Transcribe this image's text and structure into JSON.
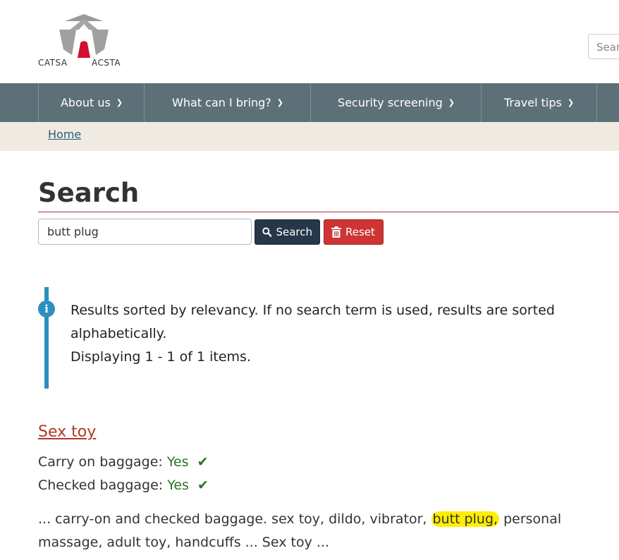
{
  "header": {
    "logo": {
      "left_text": "CATSA",
      "right_text": "ACSTA"
    },
    "search_placeholder": "Sear"
  },
  "nav": [
    {
      "label": "About us"
    },
    {
      "label": "What can I bring?"
    },
    {
      "label": "Security screening"
    },
    {
      "label": "Travel tips"
    }
  ],
  "breadcrumb": {
    "home": "Home"
  },
  "page": {
    "title": "Search"
  },
  "search_form": {
    "query": "butt plug",
    "search_label": "Search",
    "reset_label": "Reset"
  },
  "alert": {
    "message": "Results sorted by relevancy. If no search term is used, results are sorted alphabetically.",
    "count": "Displaying 1 - 1 of 1 items."
  },
  "result": {
    "title": "Sex toy",
    "carry_on_label": "Carry on baggage:",
    "carry_on_value": "Yes",
    "checked_label": "Checked baggage:",
    "checked_value": "Yes",
    "snippet_before": "... carry-on and checked baggage. sex toy, dildo, vibrator,",
    "snippet_highlight": "butt plug,",
    "snippet_after": "personal massage, adult toy, handcuffs ... Sex toy ..."
  },
  "colors": {
    "nav_bg": "#5e7077",
    "search_button": "#26374a",
    "reset_button": "#cd3434",
    "alert_accent": "#2b8fbf",
    "result_link": "#b03a24",
    "yes_green": "#27761f",
    "highlight": "#ffee00"
  },
  "icons": {
    "search_button_icon": "magnifier-icon",
    "reset_button_icon": "trash-icon",
    "alert_icon": "info-icon",
    "check_icon": "checkmark-icon",
    "nav_chevron": "chevron-down-icon"
  }
}
